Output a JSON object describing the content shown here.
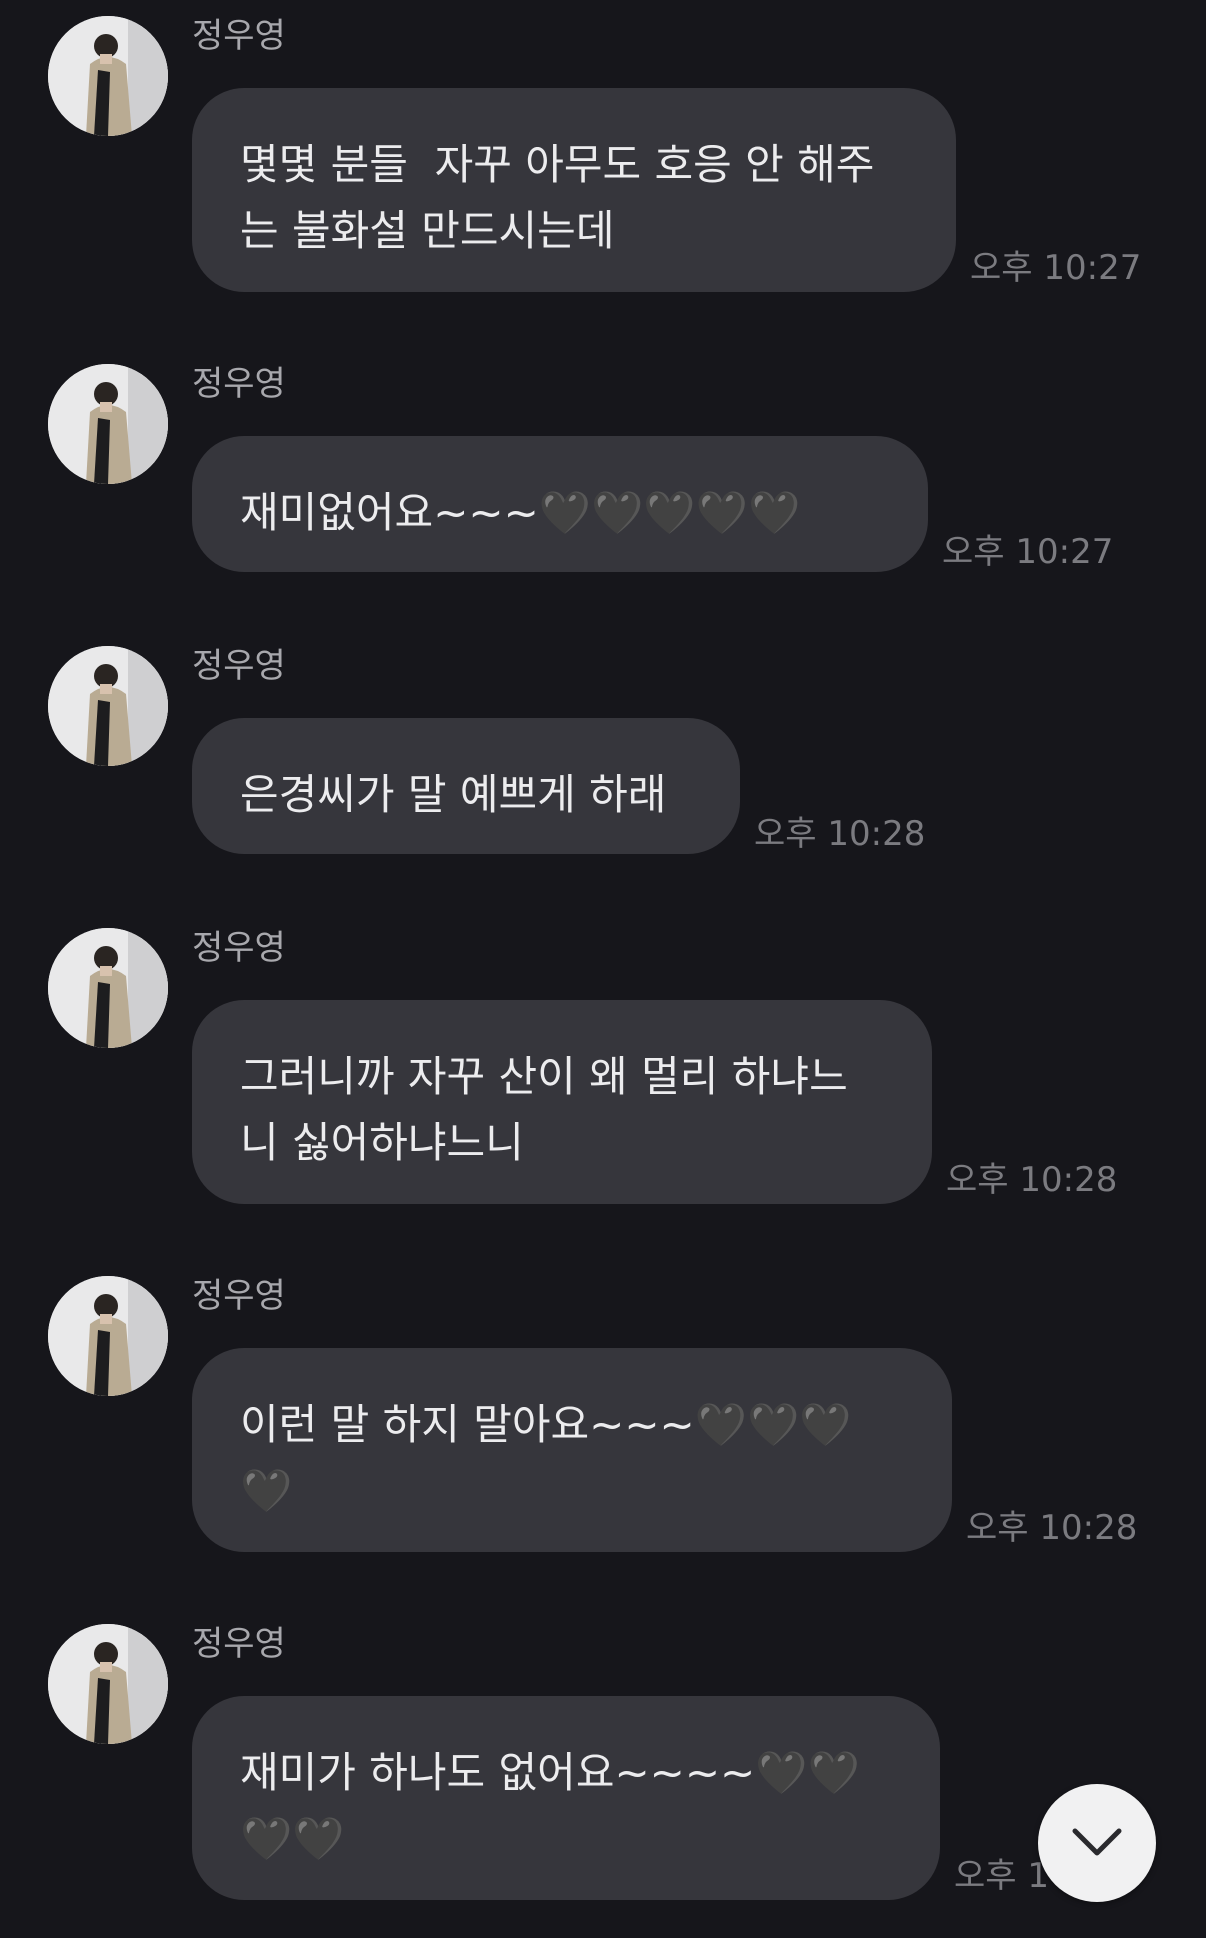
{
  "messages": [
    {
      "sender": "정우영",
      "text": "몇몇 분들  자꾸 아무도 호응 안 해주\n는 불화설 만드시는데",
      "time": "오후 10:27"
    },
    {
      "sender": "정우영",
      "text": "재미없어요~~~🖤🖤🖤🖤🖤",
      "time": "오후 10:27"
    },
    {
      "sender": "정우영",
      "text": "은경씨가 말 예쁘게 하래",
      "time": "오후 10:28"
    },
    {
      "sender": "정우영",
      "text": "그러니까 자꾸 산이 왜 멀리 하냐느\n니 싫어하냐느니",
      "time": "오후 10:28"
    },
    {
      "sender": "정우영",
      "text": "이런 말 하지 말아요~~~🖤🖤🖤\n🖤",
      "time": "오후 10:28"
    },
    {
      "sender": "정우영",
      "text": "재미가 하나도 없어요~~~~🖤🖤\n🖤🖤",
      "time": "오후 1"
    }
  ],
  "scroll_button": {
    "icon": "chevron-down-icon"
  },
  "colors": {
    "background": "#16161b",
    "bubble": "#36363c",
    "text": "#ececee",
    "sender": "#a8a8ad",
    "time": "#7b7b80"
  }
}
